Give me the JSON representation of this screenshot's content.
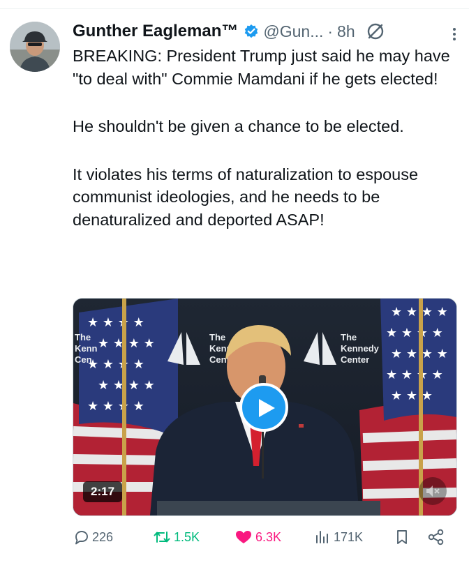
{
  "tweet": {
    "author_name": "Gunther Eagleman™",
    "handle": "@Gun...",
    "separator": "·",
    "time": "8h",
    "text_paragraphs": [
      "BREAKING: President Trump just said he may have \"to deal with\" Commie Mamdani if he gets elected!",
      "He shouldn't be given a chance to be elected.",
      "It violates his terms of naturalization to espouse communist ideologies, and he needs to be denaturalized and deported ASAP!"
    ]
  },
  "media": {
    "duration": "2:17",
    "backdrop_label_left": "The Kenn Cen",
    "backdrop_label_mid": "The Kenne Center",
    "backdrop_label_right": "The Kennedy Center"
  },
  "actions": {
    "replies": "226",
    "reposts": "1.5K",
    "likes": "6.3K",
    "views": "171K"
  },
  "colors": {
    "accent": "#1d9bf0",
    "repost_active": "#00ba7c",
    "like_active": "#f91880",
    "secondary_text": "#536471"
  }
}
